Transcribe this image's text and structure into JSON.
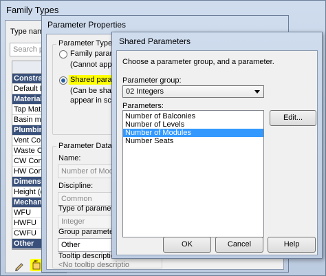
{
  "family_types": {
    "title": "Family Types",
    "type_name_label": "Type name:",
    "search_placeholder": "Search par",
    "rows": [
      {
        "label": "Constrain",
        "header": true
      },
      {
        "label": "Default Ele",
        "header": false
      },
      {
        "label": "Materials",
        "header": true
      },
      {
        "label": "Tap Mater",
        "header": false
      },
      {
        "label": "Basin mat",
        "header": false
      },
      {
        "label": "Plumbing",
        "header": true
      },
      {
        "label": "Vent Conn",
        "header": false
      },
      {
        "label": "Waste Con",
        "header": false
      },
      {
        "label": "CW Conn",
        "header": false
      },
      {
        "label": "HW Conn",
        "header": false
      },
      {
        "label": "Dimensio",
        "header": true
      },
      {
        "label": "Height (de",
        "header": false
      },
      {
        "label": "Mechanic",
        "header": true
      },
      {
        "label": "WFU",
        "header": false
      },
      {
        "label": "HWFU",
        "header": false
      },
      {
        "label": "CWFU",
        "header": false
      },
      {
        "label": "Other",
        "header": true
      }
    ],
    "pencil_icon": "pencil-icon",
    "new_parameter_icon": "new-parameter-icon"
  },
  "parameter_properties": {
    "title": "Parameter Properties",
    "parameter_type_group": "Parameter Type",
    "family_parameter_label": "Family parameter",
    "family_parameter_note": "(Cannot appear in",
    "shared_parameter_label": "Shared paramete",
    "shared_parameter_note_1": "(Can be shared by",
    "shared_parameter_note_2": "appear in schedul",
    "parameter_data_group": "Parameter Data",
    "name_label": "Name:",
    "name_value": "Number of Modules",
    "discipline_label": "Discipline:",
    "discipline_value": "Common",
    "type_label": "Type of parameter:",
    "type_value": "Integer",
    "group_label": "Group parameter un",
    "group_value": "Other",
    "tooltip_label": "Tooltip description:",
    "tooltip_value": "<No tooltip descriptio"
  },
  "shared_parameters": {
    "title": "Shared Parameters",
    "instruction": "Choose a parameter group, and a parameter.",
    "group_label": "Parameter group:",
    "group_value": "02 Integers",
    "parameters_label": "Parameters:",
    "parameters": [
      {
        "label": "Number of Balconies",
        "selected": false
      },
      {
        "label": "Number of Levels",
        "selected": false
      },
      {
        "label": "Number of Modules",
        "selected": true
      },
      {
        "label": "Number Seats",
        "selected": false
      }
    ],
    "edit_button": "Edit...",
    "ok_button": "OK",
    "cancel_button": "Cancel",
    "help_button": "Help"
  }
}
